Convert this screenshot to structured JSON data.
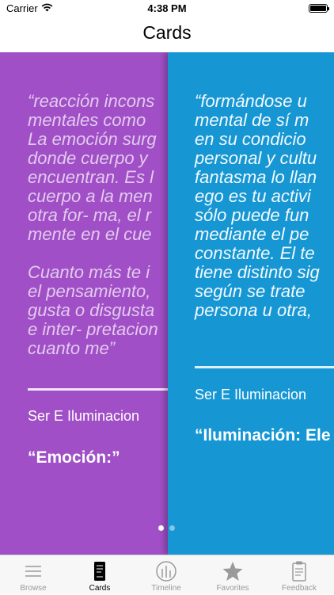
{
  "status_bar": {
    "carrier": "Carrier",
    "time": "4:38 PM"
  },
  "nav": {
    "title": "Cards"
  },
  "cards": [
    {
      "color": "#a04fc6",
      "quote": "“reacción incons\nmentales como \nLa emoción surg\ndonde cuerpo y\nencuentran. Es l\ncuerpo a la men\notra for- ma, el r\nmente en el cue\n\nCuanto más te i\nel pensamiento, \ngusta o disgusta\ne inter- pretacion\ncuanto me”",
      "author": "Ser E Iluminacion",
      "title": "“Emoción:”"
    },
    {
      "color": "#1697d4",
      "quote": "“formándose u\nmental de sí m\nen su condicio\npersonal y cultu\nfantasma lo llan\nego es tu activi\nsólo puede fun\nmediante el pe\nconstante. El te\ntiene distinto sig\nsegún se trate \npersona u otra,",
      "author": "Ser E Iluminacion",
      "title": "“Iluminación: Ele"
    }
  ],
  "page_indicator": {
    "current": 1,
    "total": 2
  },
  "tabs": [
    {
      "label": "Browse",
      "icon": "list-icon",
      "active": false
    },
    {
      "label": "Cards",
      "icon": "card-icon",
      "active": true
    },
    {
      "label": "Timeline",
      "icon": "timeline-icon",
      "active": false
    },
    {
      "label": "Favorites",
      "icon": "star-icon",
      "active": false
    },
    {
      "label": "Feedback",
      "icon": "clipboard-icon",
      "active": false
    }
  ]
}
